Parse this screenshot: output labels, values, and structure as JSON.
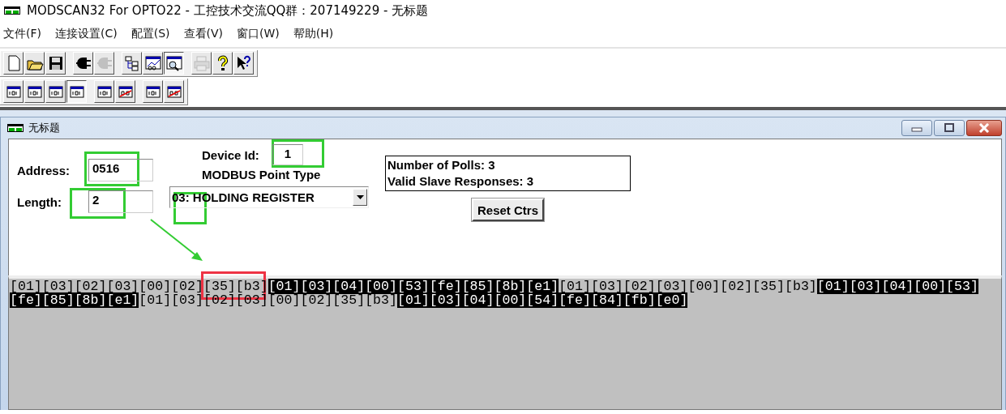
{
  "window": {
    "title": "MODSCAN32 For OPTO22 - 工控技术交流QQ群：207149229 - 无标题"
  },
  "menu": [
    "文件(F)",
    "连接设置(C)",
    "配置(S)",
    "查看(V)",
    "窗口(W)",
    "帮助(H)"
  ],
  "toolbars": [
    [
      [
        {
          "kind": "new",
          "disabled": false,
          "pressed": false
        },
        {
          "kind": "open",
          "disabled": false,
          "pressed": false
        },
        {
          "kind": "save",
          "disabled": false,
          "pressed": false
        }
      ],
      [
        {
          "kind": "connect",
          "disabled": false,
          "pressed": false
        },
        {
          "kind": "disconnect",
          "disabled": true,
          "pressed": false
        }
      ],
      [
        {
          "kind": "tree",
          "disabled": false,
          "pressed": false
        },
        {
          "kind": "chart",
          "disabled": false,
          "pressed": false
        },
        {
          "kind": "monitor",
          "disabled": false,
          "pressed": true
        }
      ],
      [
        {
          "kind": "print",
          "disabled": true,
          "pressed": false
        },
        {
          "kind": "help",
          "disabled": false,
          "pressed": false
        },
        {
          "kind": "context-help",
          "disabled": false,
          "pressed": false
        }
      ]
    ],
    [
      [
        {
          "kind": "format",
          "disabled": false,
          "pressed": false
        },
        {
          "kind": "format",
          "disabled": false,
          "pressed": false
        },
        {
          "kind": "format",
          "disabled": false,
          "pressed": false
        },
        {
          "kind": "format",
          "disabled": false,
          "pressed": true
        }
      ],
      [
        {
          "kind": "format",
          "disabled": false,
          "pressed": false
        },
        {
          "kind": "format-swapped",
          "disabled": false,
          "pressed": false
        }
      ],
      [
        {
          "kind": "format",
          "disabled": false,
          "pressed": false
        },
        {
          "kind": "format-swapped",
          "disabled": false,
          "pressed": false
        }
      ]
    ]
  ],
  "child_window": {
    "title": "无标题",
    "address": {
      "label": "Address:",
      "value": "0516"
    },
    "length": {
      "label": "Length:",
      "value": "2"
    },
    "device_id": {
      "label": "Device Id:",
      "value": "1"
    },
    "point_type": {
      "label": "MODBUS Point Type",
      "value": "03: HOLDING REGISTER"
    },
    "stats": [
      "Number of Polls: 3",
      "Valid Slave Responses: 3"
    ],
    "reset_button": "Reset Ctrs",
    "traffic": [
      {
        "kind": "tx",
        "bytes": "[01][03][02][03][00][02][35][b3]"
      },
      {
        "kind": "rx",
        "bytes": "[01][03][04][00][53][fe][85][8b][e1]"
      },
      {
        "kind": "tx",
        "bytes": "[01][03][02][03][00][02][35][b3]"
      },
      {
        "kind": "rx",
        "bytes": "[01][03][04][00][53][fe][85][8b][e1]"
      },
      {
        "kind": "tx",
        "bytes": "[01][03][02][03][00][02][35][b3]"
      },
      {
        "kind": "rx",
        "bytes": "[01][03][04][00][54][fe][84][fb][e0]"
      }
    ]
  },
  "annotations": [
    {
      "kind": "box",
      "color": "#33cc33"
    },
    {
      "kind": "box",
      "color": "#33cc33"
    },
    {
      "kind": "box",
      "color": "#33cc33"
    },
    {
      "kind": "box",
      "color": "#33cc33"
    },
    {
      "kind": "arrow",
      "color": "#33cc33"
    },
    {
      "kind": "box",
      "color": "#ee3344"
    }
  ]
}
